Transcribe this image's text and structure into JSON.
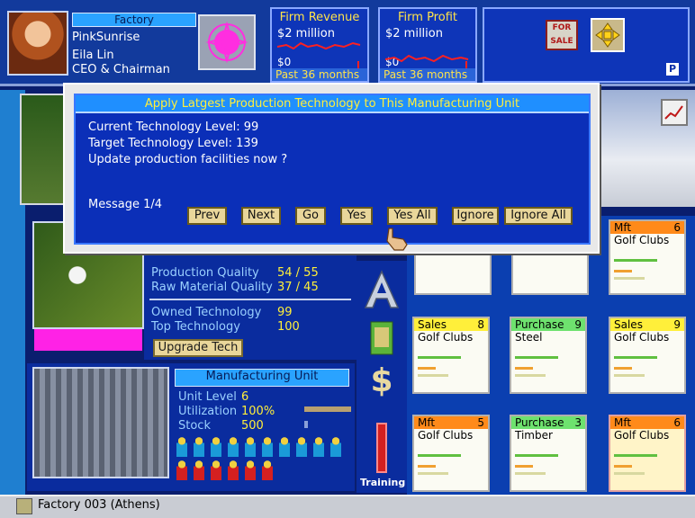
{
  "header": {
    "factory_label": "Factory",
    "firm_name": "PinkSunrise",
    "person_name": "Eila Lin",
    "person_title": "CEO & Chairman"
  },
  "revenue_chart": {
    "title": "Firm Revenue",
    "top_value": "$2 million",
    "bottom_value": "$0",
    "footer": "Past 36 months"
  },
  "profit_chart": {
    "title": "Firm Profit",
    "top_value": "$2 million",
    "bottom_value": "$0",
    "footer": "Past 36 months"
  },
  "toolbar": {
    "for_sale_label": "FOR SALE",
    "p_label": "P"
  },
  "dialog": {
    "title": "Apply Latgest Production Technology to This Manufacturing Unit",
    "line1": "Current Technology Level: 99",
    "line2": "Target Technology Level: 139",
    "line3": "Update production facilities now ?",
    "message_counter": "Message 1/4",
    "buttons": {
      "prev": "Prev",
      "next": "Next",
      "go": "Go",
      "yes": "Yes",
      "yes_all": "Yes All",
      "ignore": "Ignore",
      "ignore_all": "Ignore All"
    }
  },
  "product": {
    "production_quality_label": "Production Quality",
    "production_quality_value": "54 / 55",
    "raw_quality_label": "Raw Material Quality",
    "raw_quality_value": "37 / 45",
    "owned_tech_label": "Owned Technology",
    "owned_tech_value": "99",
    "top_tech_label": "Top Technology",
    "top_tech_value": "100",
    "upgrade_button": "Upgrade Tech"
  },
  "manufacturing": {
    "title": "Manufacturing Unit",
    "unit_level_label": "Unit Level",
    "unit_level_value": "6",
    "utilization_label": "Utilization",
    "utilization_value": "100%",
    "stock_label": "Stock",
    "stock_value": "500"
  },
  "icons": {
    "training_label": "Training"
  },
  "cells": [
    {
      "type": "Mft",
      "num": "6",
      "product": "Golf Clubs"
    },
    {
      "type": "Sales",
      "num": "8",
      "product": "Golf Clubs"
    },
    {
      "type": "Purchase",
      "num": "9",
      "product": "Steel"
    },
    {
      "type": "Sales",
      "num": "9",
      "product": "Golf Clubs"
    },
    {
      "type": "Mft",
      "num": "5",
      "product": "Golf Clubs"
    },
    {
      "type": "Purchase",
      "num": "3",
      "product": "Timber"
    },
    {
      "type": "Mft",
      "num": "6",
      "product": "Golf Clubs"
    }
  ],
  "status": {
    "text": "Factory 003 (Athens)"
  }
}
